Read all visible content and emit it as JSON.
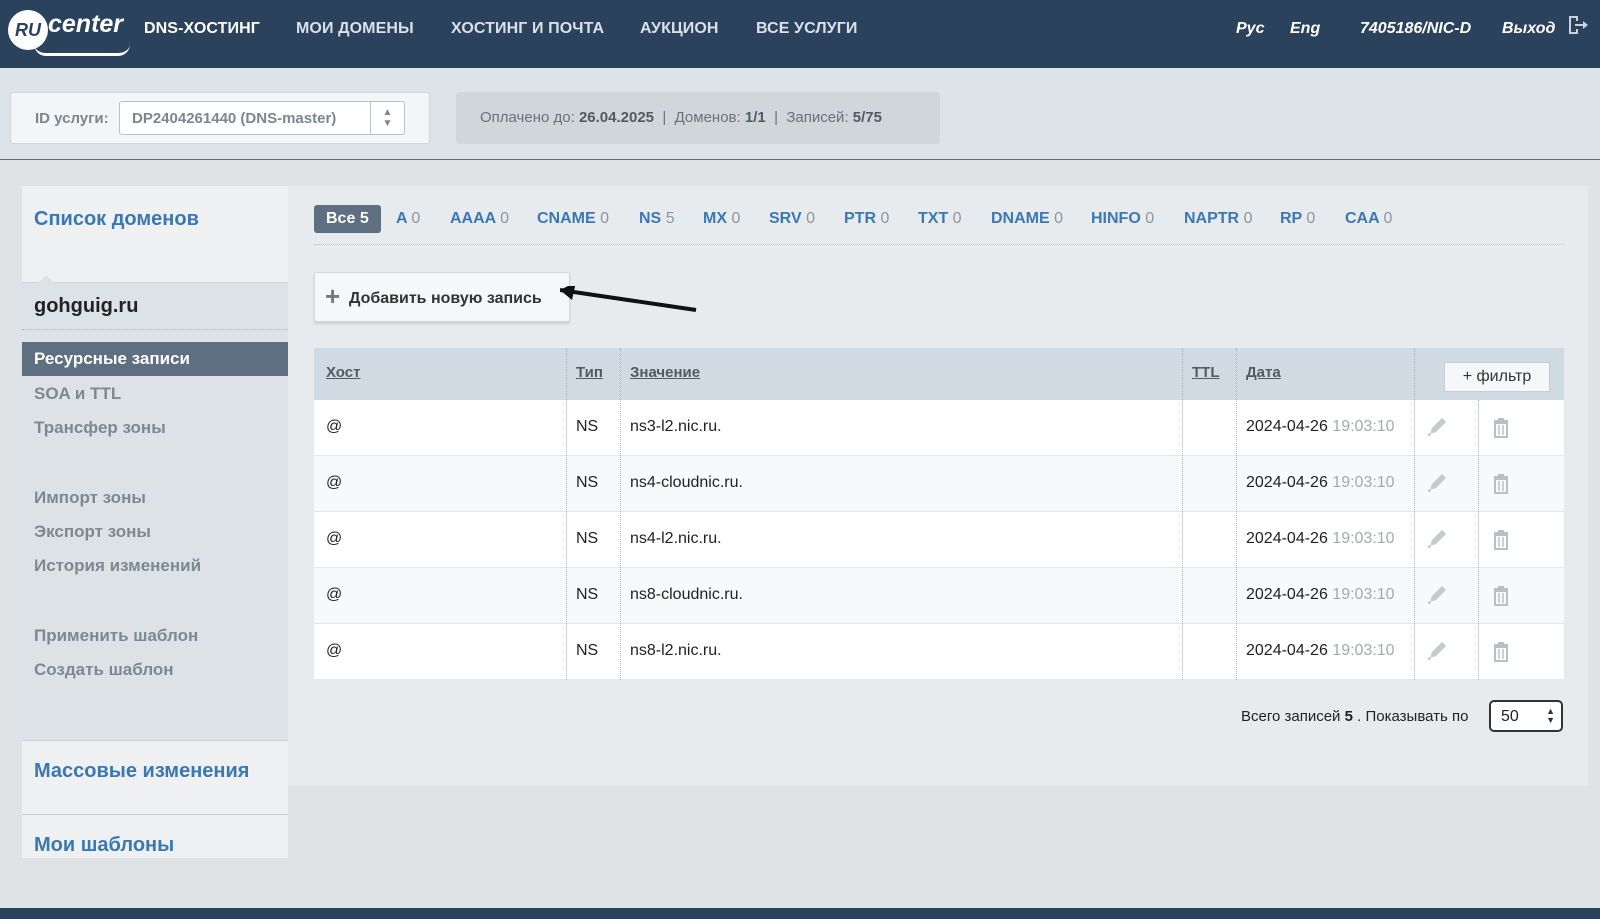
{
  "brand": {
    "logo_circle": "RU",
    "logo_word": "center"
  },
  "nav": {
    "items": [
      "DNS-ХОСТИНГ",
      "МОИ ДОМЕНЫ",
      "ХОСТИНГ И ПОЧТА",
      "АУКЦИОН",
      "ВСЕ УСЛУГИ"
    ],
    "lang_ru": "Рус",
    "lang_en": "Eng",
    "account": "7405186/NIC-D",
    "logout": "Выход"
  },
  "service": {
    "label": "ID услуги:",
    "selected": "DP2404261440 (DNS-master)",
    "paid_label": "Оплачено до:",
    "paid_value": "26.04.2025",
    "domains_label": "Доменов:",
    "domains_value": "1/1",
    "records_label": "Записей:",
    "records_value": "5/75"
  },
  "sidebar": {
    "domain_list": "Список доменов",
    "domain": "gohguig.ru",
    "links": [
      "Ресурсные записи",
      "SOA и TTL",
      "Трансфер зоны",
      "Импорт зоны",
      "Экспорт зоны",
      "История изменений",
      "Применить шаблон",
      "Создать шаблон"
    ],
    "mass_changes": "Массовые изменения",
    "my_templates": "Мои шаблоны"
  },
  "tabs": [
    {
      "label": "Все",
      "count": "5"
    },
    {
      "label": "A",
      "count": "0"
    },
    {
      "label": "AAAA",
      "count": "0"
    },
    {
      "label": "CNAME",
      "count": "0"
    },
    {
      "label": "NS",
      "count": "5"
    },
    {
      "label": "MX",
      "count": "0"
    },
    {
      "label": "SRV",
      "count": "0"
    },
    {
      "label": "PTR",
      "count": "0"
    },
    {
      "label": "TXT",
      "count": "0"
    },
    {
      "label": "DNAME",
      "count": "0"
    },
    {
      "label": "HINFO",
      "count": "0"
    },
    {
      "label": "NAPTR",
      "count": "0"
    },
    {
      "label": "RP",
      "count": "0"
    },
    {
      "label": "CAA",
      "count": "0"
    }
  ],
  "add_record": "Добавить новую запись",
  "table": {
    "headers": {
      "host": "Хост",
      "type": "Тип",
      "value": "Значение",
      "ttl": "TTL",
      "date": "Дата"
    },
    "filter": "+ фильтр",
    "rows": [
      {
        "host": "@",
        "type": "NS",
        "value": "ns3-l2.nic.ru.",
        "ttl": "",
        "date": "2024-04-26",
        "time": "19:03:10"
      },
      {
        "host": "@",
        "type": "NS",
        "value": "ns4-cloudnic.ru.",
        "ttl": "",
        "date": "2024-04-26",
        "time": "19:03:10"
      },
      {
        "host": "@",
        "type": "NS",
        "value": "ns4-l2.nic.ru.",
        "ttl": "",
        "date": "2024-04-26",
        "time": "19:03:10"
      },
      {
        "host": "@",
        "type": "NS",
        "value": "ns8-cloudnic.ru.",
        "ttl": "",
        "date": "2024-04-26",
        "time": "19:03:10"
      },
      {
        "host": "@",
        "type": "NS",
        "value": "ns8-l2.nic.ru.",
        "ttl": "",
        "date": "2024-04-26",
        "time": "19:03:10"
      }
    ]
  },
  "pager": {
    "total_label": "Всего записей",
    "total": "5",
    "show_label": ". Показывать по",
    "per_page": "50"
  },
  "colors": {
    "nav_bg": "#2b425c",
    "link": "#3a78b3",
    "active_bg": "#5d6f80"
  }
}
